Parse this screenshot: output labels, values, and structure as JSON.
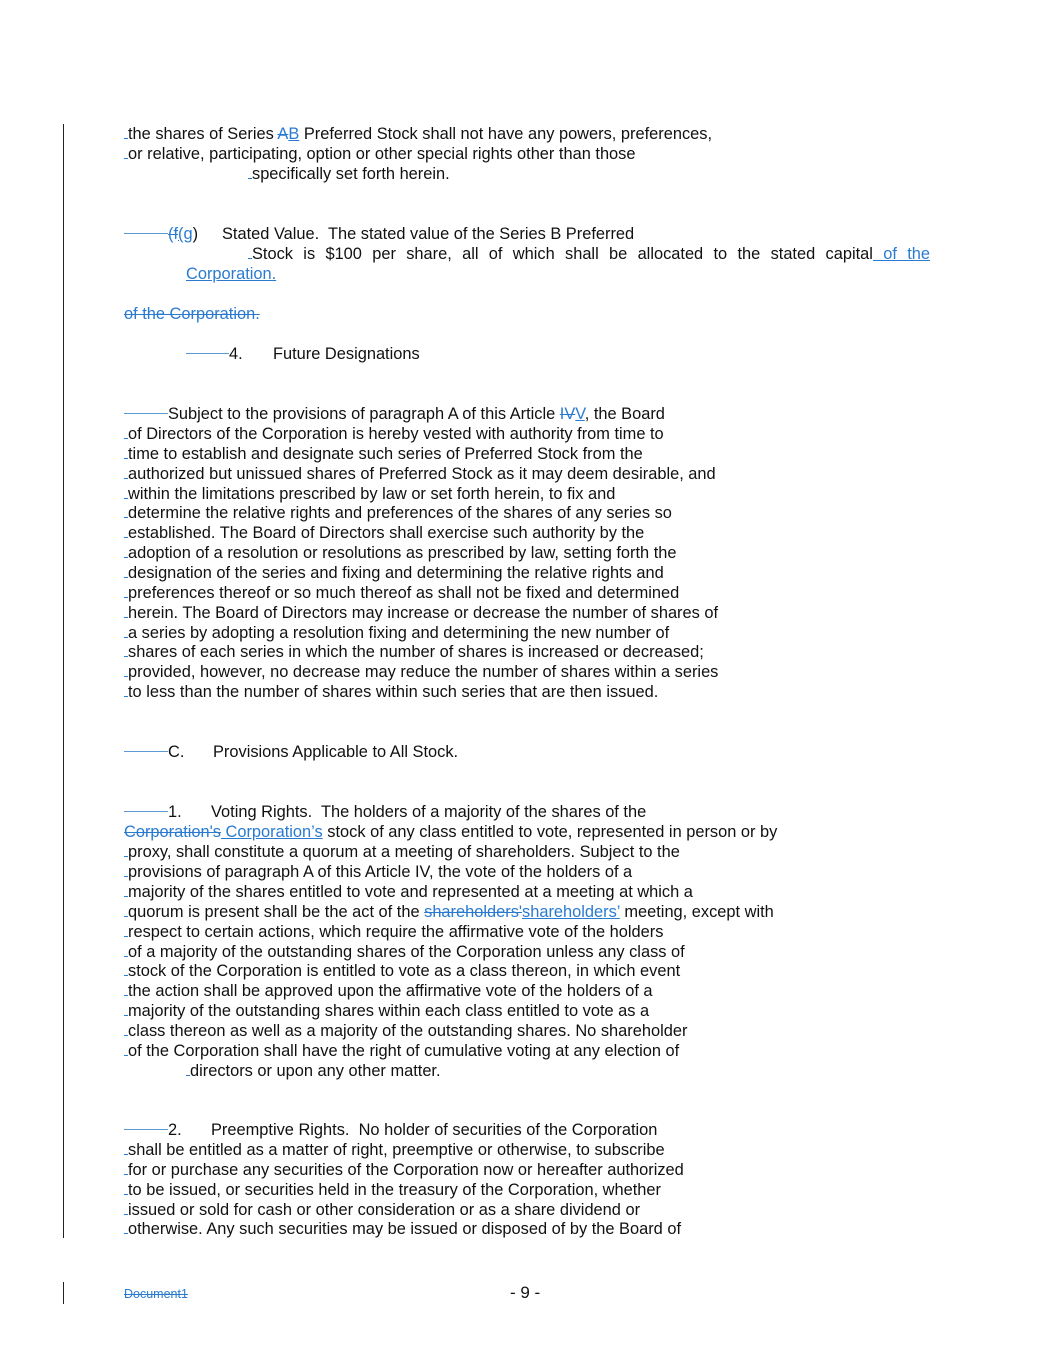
{
  "colors": {
    "revision": "#2a7bd0",
    "text": "#111111"
  },
  "lines": [
    {
      "mark": true,
      "segs": [
        {
          "k": "n",
          "t": "the shares of Series "
        },
        {
          "k": "del",
          "t": "A"
        },
        {
          "k": "ins",
          "t": "B"
        },
        {
          "k": "n",
          "t": " Preferred Stock shall not have any powers, preferences,"
        }
      ]
    },
    {
      "mark": true,
      "segs": [
        {
          "k": "n",
          "t": "or relative, participating, option or other special rights other than those"
        }
      ]
    },
    {
      "mark": true,
      "segs": [
        {
          "k": "n",
          "t": "specifically set forth herein."
        }
      ]
    },
    {
      "mark": false,
      "segs": [
        {
          "k": "tab"
        },
        {
          "k": "del",
          "t": "(f"
        },
        {
          "k": "ins",
          "t": "(g"
        },
        {
          "k": "n",
          "t": ")"
        },
        {
          "k": "n",
          "t": "Stated Value.  The stated value of the Series B Preferred"
        }
      ]
    },
    {
      "mark": true,
      "justify": true,
      "segs": [
        {
          "k": "n",
          "t": "Stock is $100 per share, all of which shall be allocated to the stated capital"
        },
        {
          "k": "ins",
          "t": " of the"
        }
      ]
    },
    {
      "mark": false,
      "segs": [
        {
          "k": "ins",
          "t": "Corporation."
        }
      ]
    },
    {
      "mark": false,
      "segs": [
        {
          "k": "del",
          "t": "of the Corporation."
        }
      ]
    },
    {
      "mark": false,
      "segs": [
        {
          "k": "tab"
        },
        {
          "k": "n",
          "t": "4."
        },
        {
          "k": "n",
          "t": "Future Designations"
        }
      ]
    },
    {
      "mark": false,
      "segs": [
        {
          "k": "tab"
        },
        {
          "k": "n",
          "t": "Subject to the provisions of paragraph A of this Article "
        },
        {
          "k": "del",
          "t": "IV"
        },
        {
          "k": "ins",
          "t": "V"
        },
        {
          "k": "n",
          "t": ", the Board"
        }
      ]
    },
    {
      "mark": true,
      "segs": [
        {
          "k": "n",
          "t": "of Directors of the Corporation is hereby vested with authority from time to"
        }
      ]
    },
    {
      "mark": true,
      "segs": [
        {
          "k": "n",
          "t": "time to establish and designate such series of Preferred Stock from the"
        }
      ]
    },
    {
      "mark": true,
      "segs": [
        {
          "k": "n",
          "t": "authorized but unissued shares of Preferred Stock as it may deem desirable, and"
        }
      ]
    },
    {
      "mark": true,
      "segs": [
        {
          "k": "n",
          "t": "within the limitations prescribed by law or set forth herein, to fix and"
        }
      ]
    },
    {
      "mark": true,
      "segs": [
        {
          "k": "n",
          "t": "determine the relative rights and preferences of the shares of any series so"
        }
      ]
    },
    {
      "mark": true,
      "segs": [
        {
          "k": "n",
          "t": "established. The Board of Directors shall exercise such authority by the"
        }
      ]
    },
    {
      "mark": true,
      "segs": [
        {
          "k": "n",
          "t": "adoption of a resolution or resolutions as prescribed by law, setting forth the"
        }
      ]
    },
    {
      "mark": true,
      "segs": [
        {
          "k": "n",
          "t": "designation of the series and fixing and determining the relative rights and"
        }
      ]
    },
    {
      "mark": true,
      "segs": [
        {
          "k": "n",
          "t": "preferences thereof or so much thereof as shall not be fixed and determined"
        }
      ]
    },
    {
      "mark": true,
      "segs": [
        {
          "k": "n",
          "t": "herein. The Board of Directors may increase or decrease the number of shares of"
        }
      ]
    },
    {
      "mark": true,
      "segs": [
        {
          "k": "n",
          "t": "a series by adopting a resolution fixing and determining the new number of"
        }
      ]
    },
    {
      "mark": true,
      "segs": [
        {
          "k": "n",
          "t": "shares of each series in which the number of shares is increased or decreased;"
        }
      ]
    },
    {
      "mark": true,
      "segs": [
        {
          "k": "n",
          "t": "provided, however, no decrease may reduce the number of shares within a series"
        }
      ]
    },
    {
      "mark": true,
      "segs": [
        {
          "k": "n",
          "t": "to less than the number of shares within such series that are then issued."
        }
      ]
    },
    {
      "mark": false,
      "segs": [
        {
          "k": "tab"
        },
        {
          "k": "n",
          "t": "C."
        },
        {
          "k": "n",
          "t": "Provisions Applicable to All Stock."
        }
      ]
    },
    {
      "mark": false,
      "segs": [
        {
          "k": "tab"
        },
        {
          "k": "n",
          "t": "1."
        },
        {
          "k": "n",
          "t": "Voting Rights.  The holders of a majority of the shares of the"
        }
      ]
    },
    {
      "mark": false,
      "segs": [
        {
          "k": "del",
          "t": "Corporation's"
        },
        {
          "k": "ins",
          "t": " Corporation’s"
        },
        {
          "k": "n",
          "t": " stock of any class entitled to vote, represented in person or by"
        }
      ]
    },
    {
      "mark": true,
      "segs": [
        {
          "k": "n",
          "t": "proxy, shall constitute a quorum at a meeting of shareholders. Subject to the"
        }
      ]
    },
    {
      "mark": true,
      "segs": [
        {
          "k": "n",
          "t": "provisions of paragraph A of this Article IV, the vote of the holders of a"
        }
      ]
    },
    {
      "mark": true,
      "segs": [
        {
          "k": "n",
          "t": "majority of the shares entitled to vote and represented at a meeting at which a"
        }
      ]
    },
    {
      "mark": true,
      "segs": [
        {
          "k": "n",
          "t": "quorum is present shall be the act of the "
        },
        {
          "k": "del",
          "t": "shareholders'"
        },
        {
          "k": "ins",
          "t": "shareholders’"
        },
        {
          "k": "n",
          "t": " meeting, except with"
        }
      ]
    },
    {
      "mark": true,
      "segs": [
        {
          "k": "n",
          "t": "respect to certain actions, which require the affirmative vote of the holders"
        }
      ]
    },
    {
      "mark": true,
      "segs": [
        {
          "k": "n",
          "t": "of a majority of the outstanding shares of the Corporation unless any class of"
        }
      ]
    },
    {
      "mark": true,
      "segs": [
        {
          "k": "n",
          "t": "stock of the Corporation is entitled to vote as a class thereon, in which event"
        }
      ]
    },
    {
      "mark": true,
      "segs": [
        {
          "k": "n",
          "t": "the action shall be approved upon the affirmative vote of the holders of a"
        }
      ]
    },
    {
      "mark": true,
      "segs": [
        {
          "k": "n",
          "t": "majority of the outstanding shares within each class entitled to vote as a"
        }
      ]
    },
    {
      "mark": true,
      "segs": [
        {
          "k": "n",
          "t": "class thereon as well as a majority of the outstanding shares. No shareholder"
        }
      ]
    },
    {
      "mark": true,
      "segs": [
        {
          "k": "n",
          "t": "of the Corporation shall have the right of cumulative voting at any election of"
        }
      ]
    },
    {
      "mark": true,
      "segs": [
        {
          "k": "n",
          "t": "directors or upon any other matter."
        }
      ]
    },
    {
      "mark": false,
      "segs": [
        {
          "k": "tab"
        },
        {
          "k": "n",
          "t": "2."
        },
        {
          "k": "n",
          "t": "Preemptive Rights.  No holder of securities of the Corporation"
        }
      ]
    },
    {
      "mark": true,
      "segs": [
        {
          "k": "n",
          "t": "shall be entitled as a matter of right, preemptive or otherwise, to subscribe"
        }
      ]
    },
    {
      "mark": true,
      "segs": [
        {
          "k": "n",
          "t": "for or purchase any securities of the Corporation now or hereafter authorized"
        }
      ]
    },
    {
      "mark": true,
      "segs": [
        {
          "k": "n",
          "t": "to be issued, or securities held in the treasury of the Corporation, whether"
        }
      ]
    },
    {
      "mark": true,
      "segs": [
        {
          "k": "n",
          "t": "issued or sold for cash or other consideration or as a share dividend or"
        }
      ]
    },
    {
      "mark": true,
      "segs": [
        {
          "k": "n",
          "t": "otherwise. Any such securities may be issued or disposed of by the Board of"
        }
      ]
    }
  ],
  "footer": {
    "document_name": "Document1",
    "page_number": "- 9 -"
  }
}
